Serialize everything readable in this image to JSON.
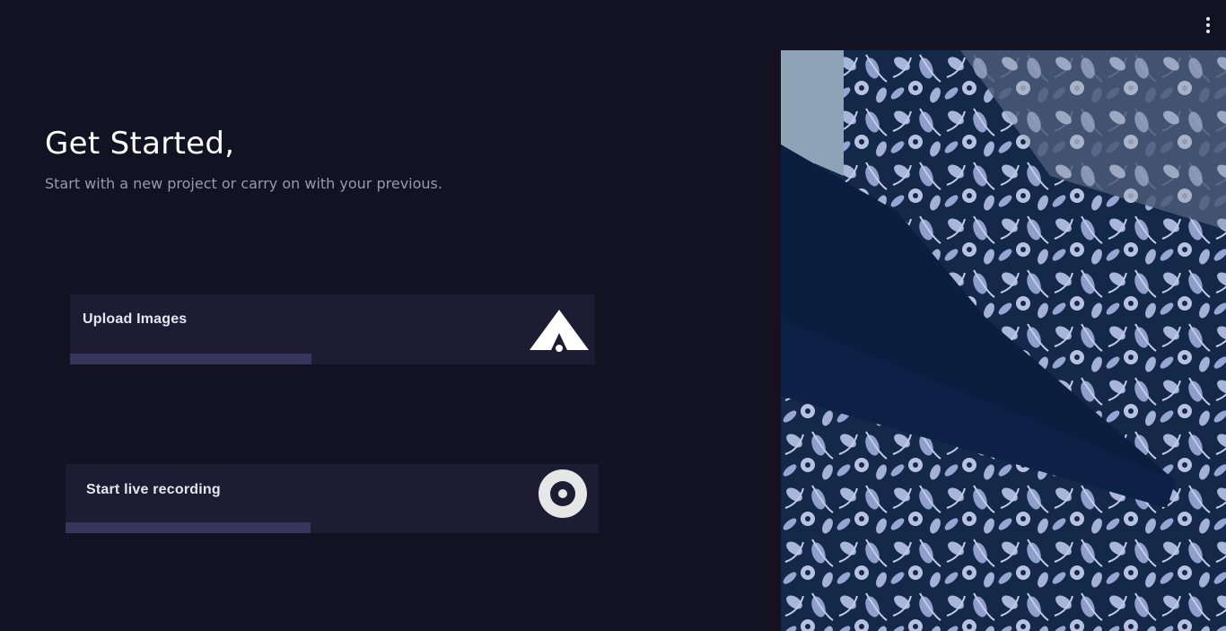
{
  "header": {
    "menu_icon": "more-vertical-icon"
  },
  "intro": {
    "title": "Get Started,",
    "subtitle": "Start with a new project or carry on with your previous."
  },
  "actions": [
    {
      "label": "Upload Images",
      "icon": "upload-icon",
      "progress": 0.46
    },
    {
      "label": "Start live recording",
      "icon": "record-icon",
      "progress": 0.46
    }
  ],
  "hero": {
    "image": "floral-fabric-pattern"
  },
  "colors": {
    "background": "#131222",
    "card": "#1e1c33",
    "bar": "#38355c",
    "subtitle": "#9a99a8",
    "hero_dark": "#0d1f3d",
    "hero_light": "#a9b6dc"
  }
}
